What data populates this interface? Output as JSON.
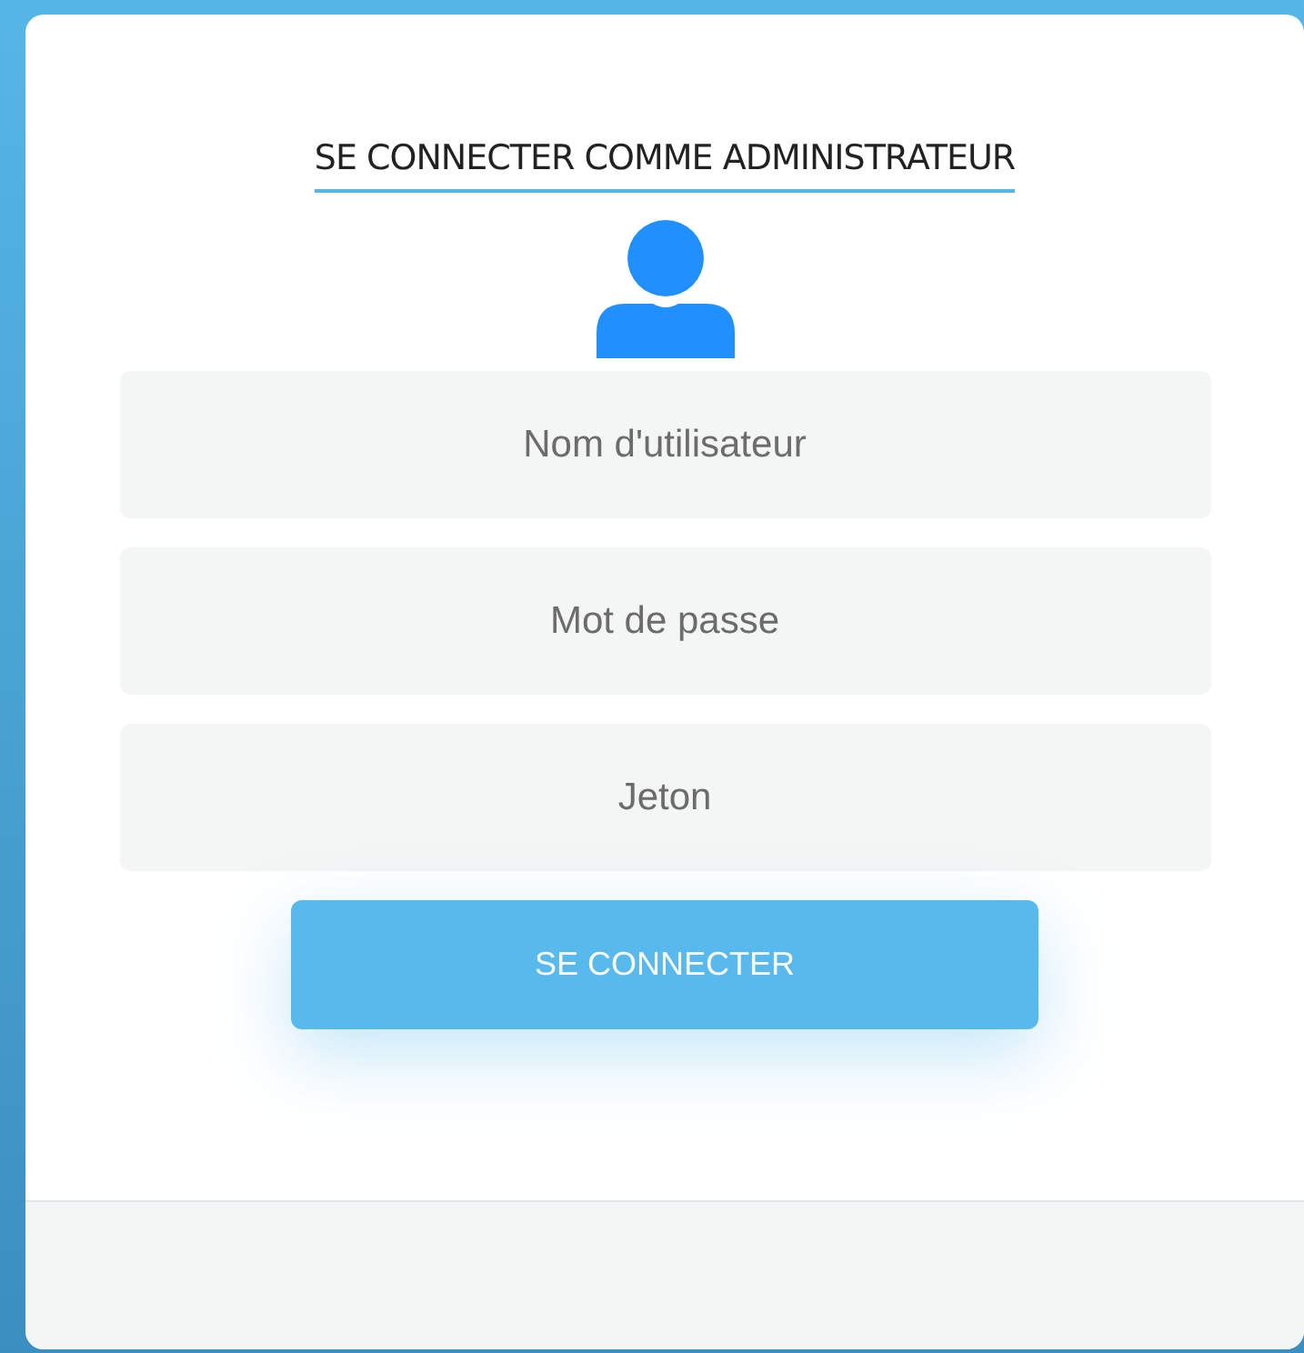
{
  "title": "SE CONNECTER COMME ADMINISTRATEUR",
  "fields": [
    {
      "placeholder": "Nom d'utilisateur"
    },
    {
      "placeholder": "Mot de passe"
    },
    {
      "placeholder": "Jeton"
    }
  ],
  "button": "SE CONNECTER"
}
